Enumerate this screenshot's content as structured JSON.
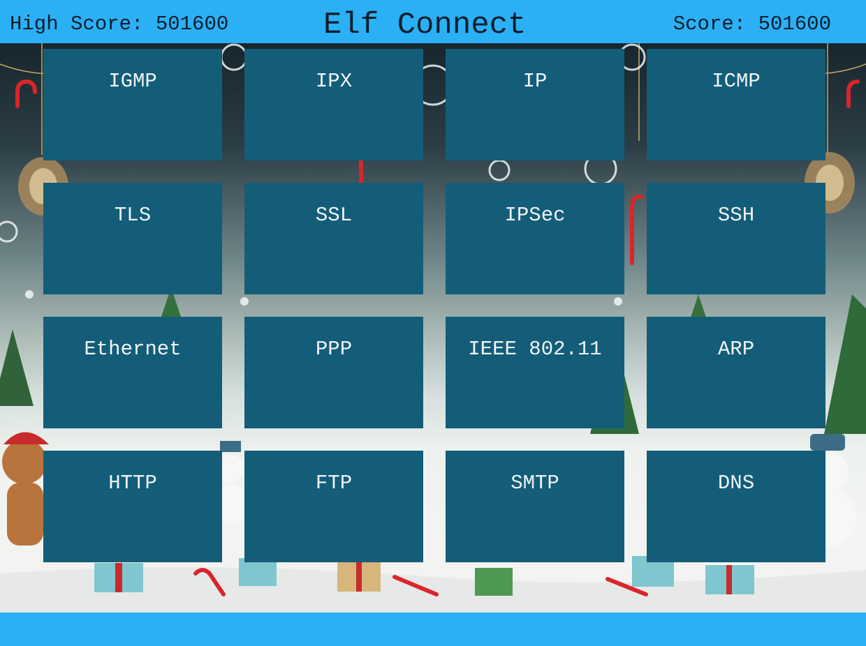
{
  "header": {
    "high_score_label": "High Score: 501600",
    "title": "Elf Connect",
    "score_label": "Score: 501600"
  },
  "colors": {
    "bar": "#2bb0f5",
    "tile": "#135d79",
    "tile_text": "#f1f4f6",
    "header_text": "#0b1d2a"
  },
  "tiles": [
    [
      "IGMP",
      "IPX",
      "IP",
      "ICMP"
    ],
    [
      "TLS",
      "SSL",
      "IPSec",
      "SSH"
    ],
    [
      "Ethernet",
      "PPP",
      "IEEE 802.11",
      "ARP"
    ],
    [
      "HTTP",
      "FTP",
      "SMTP",
      "DNS"
    ]
  ],
  "background_icons": [
    "snowflake-icon",
    "candy-cane-icon",
    "christmas-tree-icon",
    "snowman-icon",
    "gift-box-icon",
    "lantern-icon",
    "gingerbread-icon"
  ]
}
